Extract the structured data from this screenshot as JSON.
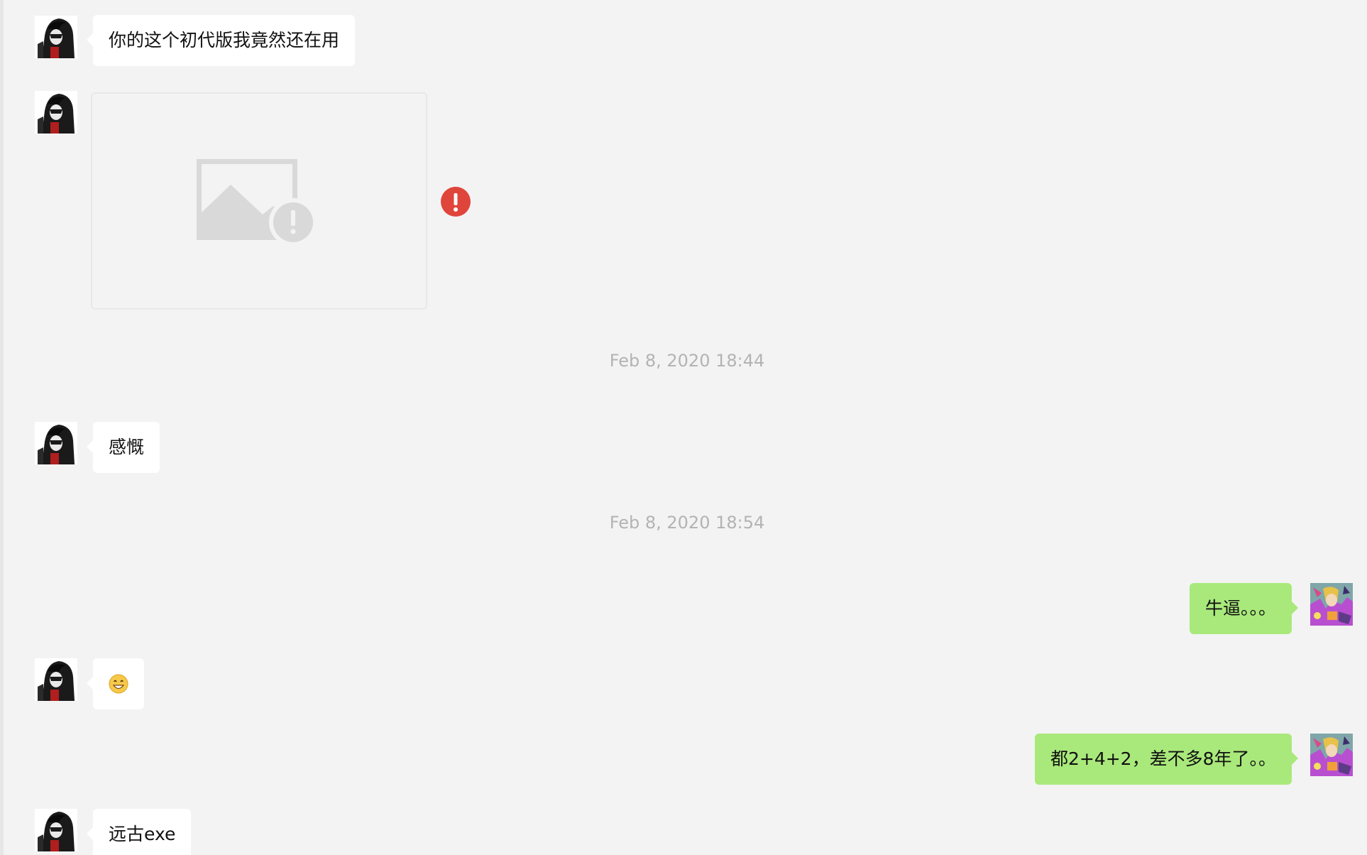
{
  "messages": [
    {
      "side": "left",
      "text": "你的这个初代版我竟然还在用"
    },
    {
      "side": "left",
      "type": "image",
      "status": "failed"
    },
    {
      "type": "timestamp",
      "text": "Feb 8, 2020 18:44"
    },
    {
      "side": "left",
      "text": "感慨"
    },
    {
      "type": "timestamp",
      "text": "Feb 8, 2020 18:54"
    },
    {
      "side": "right",
      "text": "牛逼。。。"
    },
    {
      "side": "left",
      "text": "😄"
    },
    {
      "side": "right",
      "text": "都2+4+2，差不多8年了。。"
    },
    {
      "side": "left",
      "text": "远古exe"
    }
  ],
  "colors": {
    "background": "#f3f3f3",
    "incoming_bubble": "#ffffff",
    "outgoing_bubble": "#a9e97b",
    "timestamp": "#b3b3b3",
    "error": "#e0453b"
  },
  "icons": {
    "contact_avatar": "dark-hooded-character-avatar",
    "self_avatar": "colorful-anime-avatar",
    "image_failed": "broken-image-icon",
    "send_failed": "exclamation-error-icon"
  }
}
